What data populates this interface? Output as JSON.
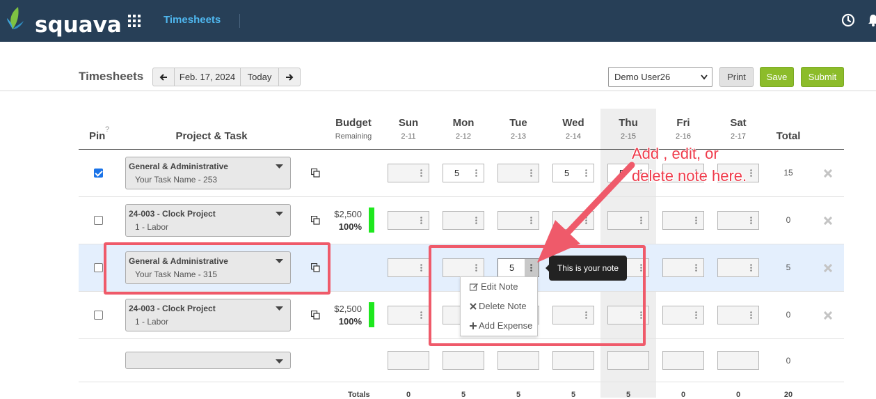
{
  "brand": {
    "name": "squava"
  },
  "nav": {
    "link": "Timesheets"
  },
  "header": {
    "title": "Timesheets",
    "date": "Feb. 17, 2024",
    "today": "Today",
    "user": "Demo User26",
    "print": "Print",
    "save": "Save",
    "submit": "Submit"
  },
  "columns": {
    "pin": "Pin",
    "pin_help": "?",
    "project_task": "Project & Task",
    "budget": "Budget",
    "budget_sub": "Remaining",
    "total": "Total",
    "days": [
      {
        "name": "Sun",
        "date": "2-11"
      },
      {
        "name": "Mon",
        "date": "2-12"
      },
      {
        "name": "Tue",
        "date": "2-13"
      },
      {
        "name": "Wed",
        "date": "2-14"
      },
      {
        "name": "Thu",
        "date": "2-15"
      },
      {
        "name": "Fri",
        "date": "2-16"
      },
      {
        "name": "Sat",
        "date": "2-17"
      }
    ]
  },
  "rows": [
    {
      "pinned": true,
      "project": "General & Administrative",
      "task": "Your Task Name - 253",
      "budget_amount": "",
      "budget_pct": "",
      "hours": [
        "",
        "5",
        "",
        "5",
        "5",
        "",
        ""
      ],
      "total": "15"
    },
    {
      "pinned": false,
      "project": "24-003 - Clock Project",
      "task": "1 - Labor",
      "budget_amount": "$2,500",
      "budget_pct": "100%",
      "hours": [
        "",
        "",
        "",
        "",
        "",
        "",
        ""
      ],
      "total": "0"
    },
    {
      "pinned": false,
      "project": "General & Administrative",
      "task": "Your Task Name - 315",
      "budget_amount": "",
      "budget_pct": "",
      "hours": [
        "",
        "",
        "5",
        "",
        "",
        "",
        ""
      ],
      "total": "5"
    },
    {
      "pinned": false,
      "project": "24-003 - Clock Project",
      "task": "1 - Labor",
      "budget_amount": "$2,500",
      "budget_pct": "100%",
      "hours": [
        "",
        "",
        "",
        "",
        "",
        "",
        ""
      ],
      "total": "0"
    }
  ],
  "new_row": {
    "total": "0"
  },
  "totals": {
    "label": "Totals",
    "days": [
      "0",
      "5",
      "5",
      "5",
      "5",
      "0",
      "0"
    ],
    "grand": "20"
  },
  "note_menu": {
    "edit": "Edit Note",
    "delete": "Delete Note",
    "add_expense": "Add Expense"
  },
  "tooltip": "This is your note",
  "annotation": {
    "line1": "Add , edit, or",
    "line2": "delete note here."
  },
  "colors": {
    "navbar": "#273f57",
    "accent": "#4fb7ef",
    "green": "#8cbc2a",
    "annotation": "#ef5a6a"
  }
}
